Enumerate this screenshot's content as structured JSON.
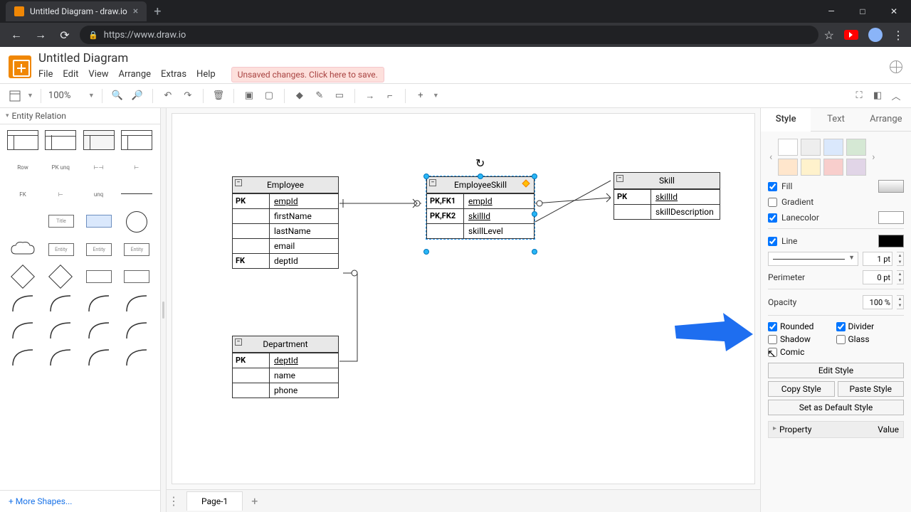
{
  "browser": {
    "tab_title": "Untitled Diagram - draw.io",
    "url": "https://www.draw.io",
    "new_tab": "+"
  },
  "app": {
    "title": "Untitled Diagram",
    "menu": [
      "File",
      "Edit",
      "View",
      "Arrange",
      "Extras",
      "Help"
    ],
    "unsaved": "Unsaved changes. Click here to save."
  },
  "toolbar": {
    "zoom": "100%"
  },
  "sidebar": {
    "section": "Entity Relation",
    "row_label": "Row",
    "more": "+ More Shapes..."
  },
  "canvas": {
    "tables": {
      "employee": {
        "title": "Employee",
        "rows": [
          {
            "key": "PK",
            "field": "empId",
            "u": true
          },
          {
            "key": "",
            "field": "firstName"
          },
          {
            "key": "",
            "field": "lastName"
          },
          {
            "key": "",
            "field": "email"
          },
          {
            "key": "FK",
            "field": "deptId"
          }
        ]
      },
      "employee_skill": {
        "title": "EmployeeSkill",
        "rows": [
          {
            "key": "PK,FK1",
            "field": "empId",
            "u": true
          },
          {
            "key": "PK,FK2",
            "field": "skillId",
            "u": true
          },
          {
            "key": "",
            "field": "skillLevel"
          }
        ]
      },
      "skill": {
        "title": "Skill",
        "rows": [
          {
            "key": "PK",
            "field": "skillId",
            "u": true
          },
          {
            "key": "",
            "field": "skillDescription"
          }
        ]
      },
      "department": {
        "title": "Department",
        "rows": [
          {
            "key": "PK",
            "field": "deptId",
            "u": true
          },
          {
            "key": "",
            "field": "name"
          },
          {
            "key": "",
            "field": "phone"
          }
        ]
      }
    }
  },
  "pages": {
    "page1": "Page-1"
  },
  "panel": {
    "tabs": [
      "Style",
      "Text",
      "Arrange"
    ],
    "swatches": [
      "#ffffff",
      "#eeeeee",
      "#d5e8d4",
      "#dae8fc",
      "#ffe6cc",
      "#f8cecc",
      "#fff2cc",
      "#e1d5e7"
    ],
    "fill": "Fill",
    "gradient": "Gradient",
    "lanecolor": "Lanecolor",
    "line": "Line",
    "line_width": "1 pt",
    "perimeter": "Perimeter",
    "perimeter_val": "0 pt",
    "opacity": "Opacity",
    "opacity_val": "100 %",
    "rounded": "Rounded",
    "divider": "Divider",
    "shadow": "Shadow",
    "glass": "Glass",
    "comic": "Comic",
    "edit_style": "Edit Style",
    "copy_style": "Copy Style",
    "paste_style": "Paste Style",
    "default_style": "Set as Default Style",
    "property": "Property",
    "value": "Value"
  }
}
